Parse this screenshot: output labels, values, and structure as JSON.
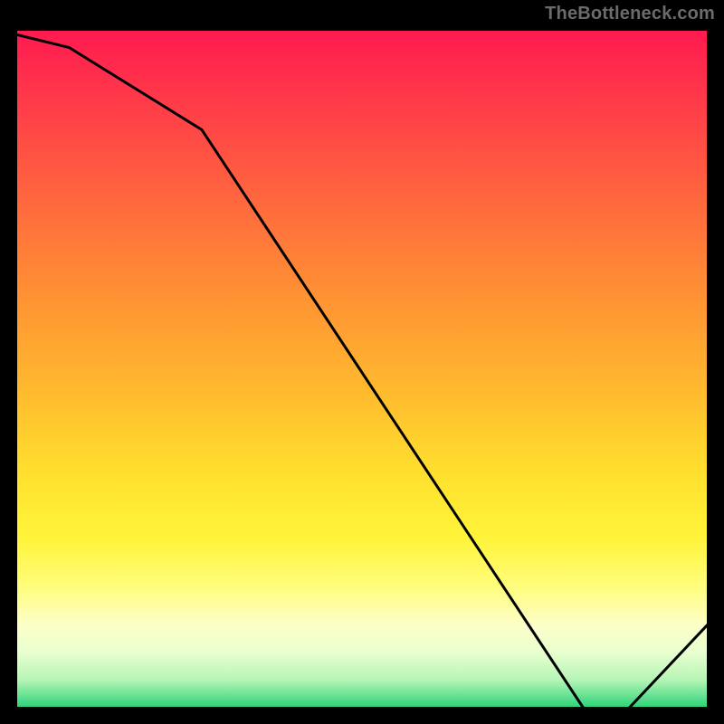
{
  "watermark": "TheBottleneck.com",
  "colors": {
    "line": "#000000",
    "label": "#d84040"
  },
  "chart_data": {
    "type": "line",
    "title": "",
    "xlabel": "",
    "ylabel": "",
    "xlim": [
      0,
      100
    ],
    "ylim": [
      0,
      100
    ],
    "x": [
      0,
      8,
      27,
      82,
      88,
      100
    ],
    "values": [
      99,
      97,
      85,
      0,
      0,
      13
    ],
    "bottom_annotation": {
      "text": "",
      "x_percent": 85
    },
    "notes": "Vertical axis reads as percentage; curve descends from top-left, flattens near zero around x≈82–88, then rises slightly at the right edge. The figure is a vertical heat gradient (red→green) behind a single black line series."
  }
}
